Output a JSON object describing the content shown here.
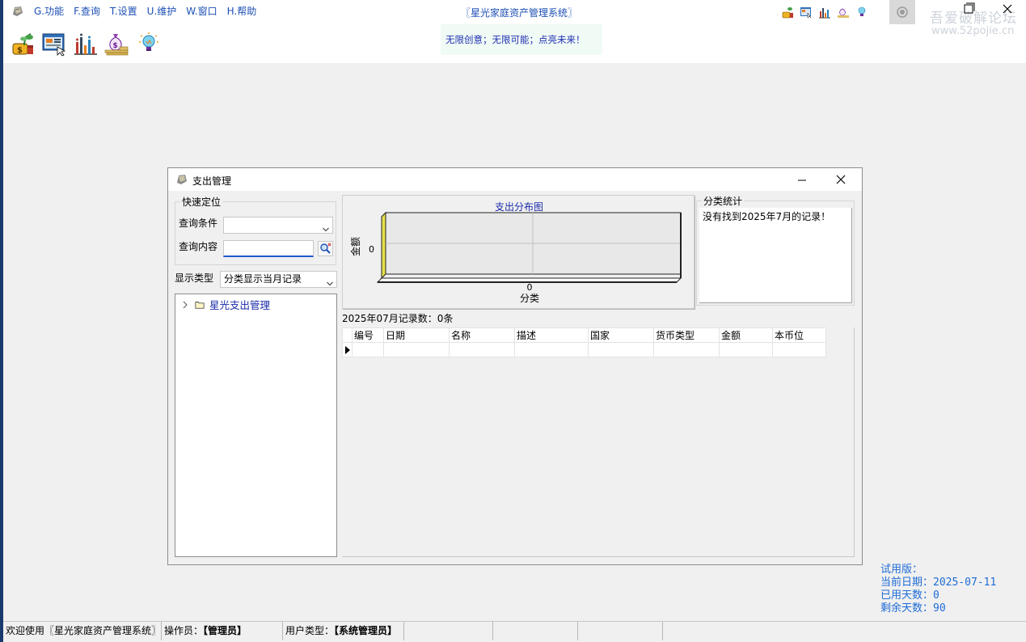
{
  "app": {
    "title": "〖星光家庭资产管理系统〗",
    "slogan": "无限创意；无限可能；点亮未来！",
    "watermark_line1": "吾爱破解论坛",
    "watermark_line2": "www.52pojie.cn"
  },
  "menu": [
    {
      "label": "G.功能"
    },
    {
      "label": "F.查询"
    },
    {
      "label": "T.设置"
    },
    {
      "label": "U.维护"
    },
    {
      "label": "W.窗口"
    },
    {
      "label": "H.帮助"
    }
  ],
  "toolbar_icons": [
    "money-plant-icon",
    "web-screen-icon",
    "bar-chart-icon",
    "money-bag-icon",
    "lightbulb-icon"
  ],
  "window": {
    "title": "支出管理",
    "quick_locate": {
      "label": "快速定位",
      "query_condition_label": "查询条件",
      "query_condition_value": "",
      "query_content_label": "查询内容",
      "query_content_value": ""
    },
    "display_type": {
      "label": "显示类型",
      "value": "分类显示当月记录"
    },
    "tree": {
      "root_label": "星光支出管理"
    },
    "category_stats": {
      "label": "分类统计",
      "text": "没有找到2025年7月的记录！"
    },
    "record_count": "2025年07月记录数：0条",
    "grid": {
      "columns": [
        "编号",
        "日期",
        "名称",
        "描述",
        "国家",
        "货币类型",
        "金额",
        "本币位"
      ],
      "rows": []
    }
  },
  "chart_data": {
    "type": "bar",
    "title": "支出分布图",
    "xlabel": "分类",
    "ylabel": "金额",
    "categories": [],
    "values": [],
    "y_tick_labels": [
      "0"
    ],
    "x_tick_labels": [
      "0"
    ],
    "grid": true,
    "three_d": true,
    "colors": {
      "title": "#1a2aa8",
      "wall": "#e8e8e8",
      "floor_edge": "#222222",
      "axis_accent": "#e4e04a"
    }
  },
  "trial": {
    "version_label": "试用版：",
    "current_date": "当前日期：2025-07-11",
    "used_days": "已用天数：0",
    "remaining_days": "剩余天数：90"
  },
  "status": {
    "welcome": "欢迎使用〖星光家庭资产管理系统〗",
    "operator_label": "操作员：",
    "operator_value": "【管理员】",
    "user_type_label": "用户类型：",
    "user_type_value": "【系统管理员】"
  },
  "colors": {
    "menu_text": "#1c4fb4",
    "slogan_bg": "#f1fbf6",
    "trial_text": "#1e6bd6",
    "tree_text": "#1a2aa8",
    "taskbar_blue": "#1a3a6e"
  }
}
